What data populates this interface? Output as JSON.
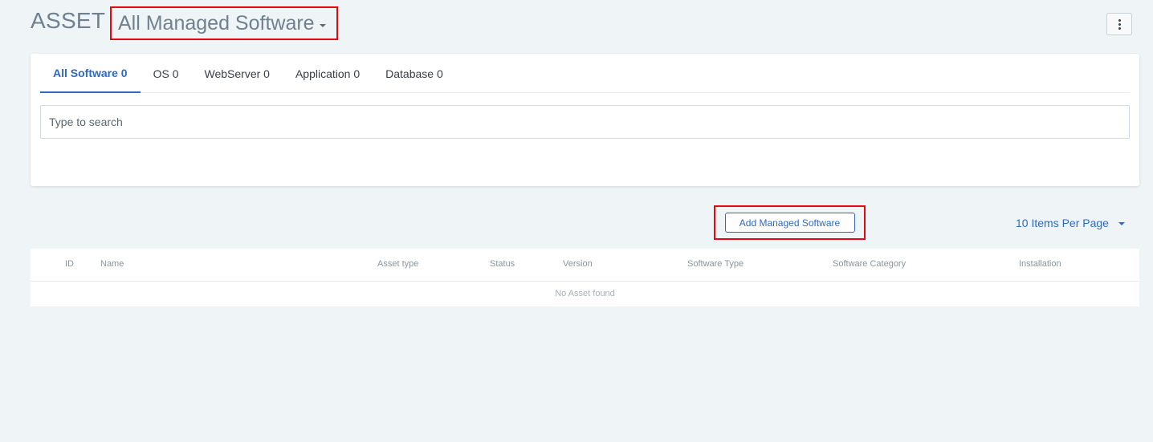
{
  "header": {
    "title": "ASSET",
    "view_selector": "All Managed Software"
  },
  "tabs": [
    {
      "label": "All Software 0",
      "active": true
    },
    {
      "label": "OS 0",
      "active": false
    },
    {
      "label": "WebServer 0",
      "active": false
    },
    {
      "label": "Application 0",
      "active": false
    },
    {
      "label": "Database 0",
      "active": false
    }
  ],
  "search": {
    "placeholder": "Type to search",
    "value": ""
  },
  "toolbar": {
    "add_label": "Add Managed Software",
    "per_page_label": "10 Items Per Page"
  },
  "table": {
    "columns": [
      "ID",
      "Name",
      "Asset type",
      "Status",
      "Version",
      "Software Type",
      "Software Category",
      "Installation"
    ],
    "empty_message": "No Asset found"
  },
  "colors": {
    "accent": "#2f6ac2",
    "highlight": "#e8060f",
    "background": "#eff4f7"
  }
}
